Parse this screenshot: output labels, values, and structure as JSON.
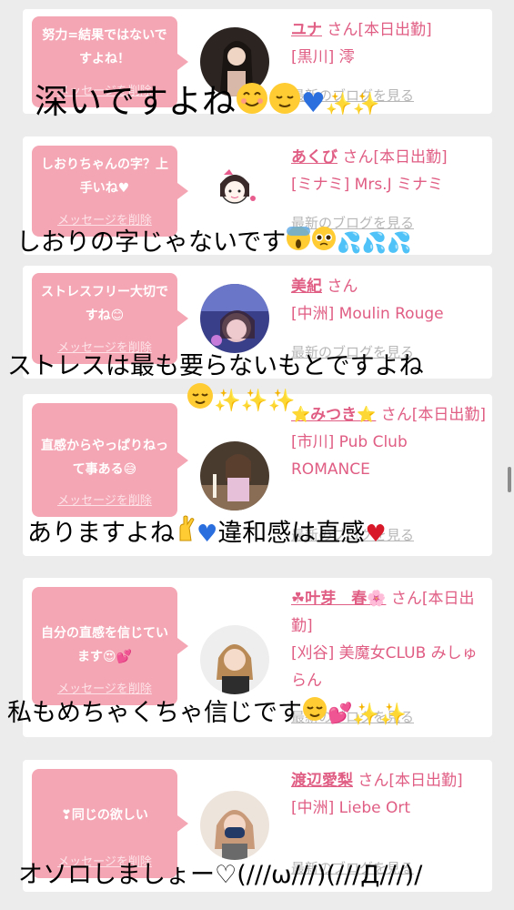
{
  "cards": [
    {
      "message": "努力=結果ではないですよね！",
      "delete_label": "メッセージを削除",
      "name": "ユナ",
      "san": "さん[本日出勤]",
      "shop": "[黒川] 澪",
      "blog_label": "最新のブログを見る"
    },
    {
      "message": "しおりちゃんの字？上手いね♥",
      "delete_label": "メッセージを削除",
      "name": "あくび",
      "san": "さん[本日出勤]",
      "shop": "[ミナミ] Mrs.J ミナミ",
      "blog_label": "最新のブログを見る"
    },
    {
      "message": "ストレスフリー大切ですね😊",
      "delete_label": "メッセージを削除",
      "name": "美紀",
      "san": "さん",
      "shop": "[中洲] Moulin Rouge",
      "blog_label": "最新のブログを見る"
    },
    {
      "message": "直感からやっぱりねって事ある😅",
      "delete_label": "メッセージを削除",
      "name": "⭐みつき⭐",
      "san": "さん[本日出勤]",
      "shop": "[市川] Pub Club ROMANCE",
      "blog_label": "最新のブログを見る"
    },
    {
      "message": "自分の直感を信じています😍💕",
      "delete_label": "メッセージを削除",
      "name": "☘叶芽　春🌸",
      "san": "さん[本日出勤]",
      "shop": "[刈谷] 美魔女CLUB みしゅらん",
      "blog_label": "最新のブログを見る"
    },
    {
      "message": "❣同じの欲しい",
      "delete_label": "メッセージを削除",
      "name": "渡辺愛梨",
      "san": "さん[本日出勤]",
      "shop": "[中洲] Liebe Ort",
      "blog_label": "最新のブログを見る"
    }
  ],
  "overlays": [
    "深いですよね",
    "しおりの字じゃないです",
    "ストレスは最も要らないもとですよね",
    "ありますよね",
    "違和感は直感",
    "私もめちゃくちゃ信じです",
    "オソロしましょー♡(///ω///)(///Д///)/"
  ],
  "icons": {
    "smile": "smiling-face-icon",
    "relieved": "relieved-face-icon",
    "blue_heart": "blue-heart-icon",
    "red_heart": "red-heart-icon",
    "sparkles": "sparkles-icon",
    "sweat": "sweat-droplets-icon",
    "scream": "screaming-face-icon",
    "pleading": "pleading-face-icon",
    "crossed_fingers": "crossed-fingers-icon",
    "two_hearts": "two-hearts-icon"
  },
  "colors": {
    "bubble": "#f4a6b4",
    "name": "#e05d84",
    "background": "#ececec"
  }
}
